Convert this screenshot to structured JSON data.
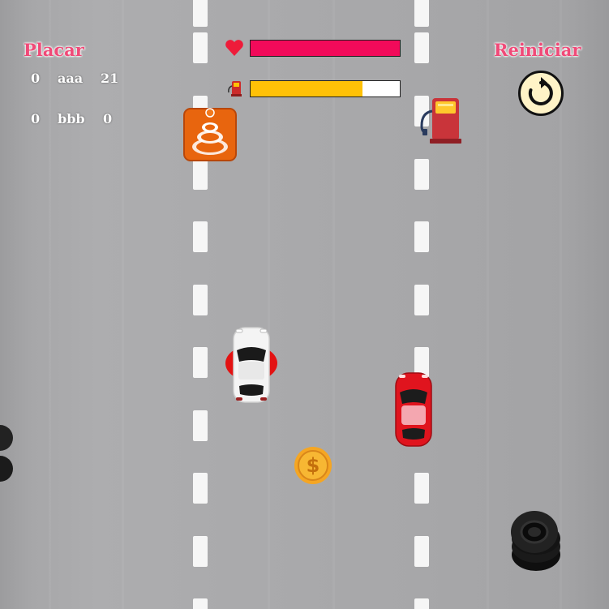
{
  "hud": {
    "scoreboard_title": "Placar",
    "restart_label": "Reiniciar",
    "scores": [
      {
        "left": "0",
        "name": "aaa",
        "value": "21"
      },
      {
        "left": "0",
        "name": "bbb",
        "value": "0"
      }
    ]
  },
  "status": {
    "health_fraction": 1.0,
    "fuel_fraction": 0.75,
    "health_color": "#f20a5a",
    "fuel_color": "#ffc107"
  },
  "icons": {
    "health": "heart-icon",
    "fuel": "fuel-pump-icon",
    "restart": "restart-icon"
  },
  "entities": {
    "player": "white-car",
    "opponent": "red-car",
    "pickups": [
      "fuel-pump",
      "coin"
    ],
    "obstacles": [
      "traffic-cone",
      "tire-stack"
    ]
  },
  "colors": {
    "title_pink": "#f04a78",
    "coin": "#f5a623",
    "cone": "#e8650e"
  }
}
